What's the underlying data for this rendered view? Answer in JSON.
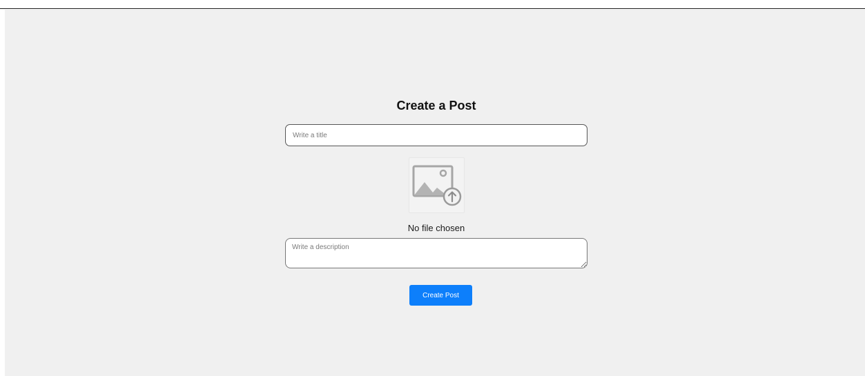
{
  "form": {
    "heading": "Create a Post",
    "title_input": {
      "placeholder": "Write a title",
      "value": ""
    },
    "image_upload": {
      "icon": "image-upload-icon",
      "status": "No file chosen"
    },
    "description_input": {
      "placeholder": "Write a description",
      "value": ""
    },
    "submit_label": "Create Post"
  },
  "colors": {
    "background": "#f0f0f0",
    "accent": "#0d7ffb",
    "input_border": "#555555"
  }
}
